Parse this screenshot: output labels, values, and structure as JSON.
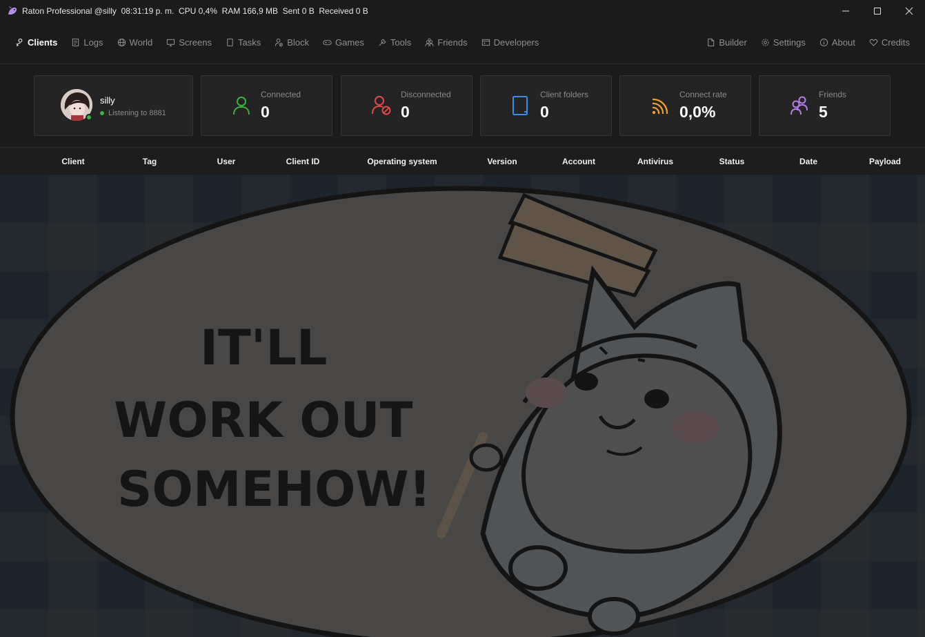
{
  "window": {
    "title": "Raton Professional @silly  08:31:19 p. m.  CPU 0,4%  RAM 166,9 MB  Sent 0 B  Received 0 B"
  },
  "nav": {
    "left": [
      {
        "label": "Clients",
        "icon": "clients-icon",
        "active": true
      },
      {
        "label": "Logs",
        "icon": "logs-icon"
      },
      {
        "label": "World",
        "icon": "world-icon"
      },
      {
        "label": "Screens",
        "icon": "screens-icon"
      },
      {
        "label": "Tasks",
        "icon": "tasks-icon"
      },
      {
        "label": "Block",
        "icon": "block-icon"
      },
      {
        "label": "Games",
        "icon": "games-icon"
      },
      {
        "label": "Tools",
        "icon": "tools-icon"
      },
      {
        "label": "Friends",
        "icon": "friends-icon"
      },
      {
        "label": "Developers",
        "icon": "developers-icon"
      }
    ],
    "right": [
      {
        "label": "Builder",
        "icon": "builder-icon"
      },
      {
        "label": "Settings",
        "icon": "settings-icon"
      },
      {
        "label": "About",
        "icon": "about-icon"
      },
      {
        "label": "Credits",
        "icon": "credits-icon"
      }
    ]
  },
  "profile": {
    "name": "silly",
    "status": "Listening to 8881"
  },
  "stats": [
    {
      "label": "Connected",
      "value": "0",
      "icon": "user-connected-icon",
      "color": "#3cb043"
    },
    {
      "label": "Disconnected",
      "value": "0",
      "icon": "user-disconnected-icon",
      "color": "#e04848"
    },
    {
      "label": "Client folders",
      "value": "0",
      "icon": "folder-icon",
      "color": "#3a8ee6"
    },
    {
      "label": "Connect rate",
      "value": "0,0%",
      "icon": "signal-icon",
      "color": "#f0a030"
    },
    {
      "label": "Friends",
      "value": "5",
      "icon": "friends-group-icon",
      "color": "#b47ee6"
    }
  ],
  "table": {
    "columns": [
      "Client",
      "Tag",
      "User",
      "Client ID",
      "Operating system",
      "Version",
      "Account",
      "Antivirus",
      "Status",
      "Date",
      "Payload"
    ]
  },
  "background": {
    "text_lines": [
      "IT'LL",
      "WORK OUT",
      "SOMEHOW!"
    ]
  }
}
